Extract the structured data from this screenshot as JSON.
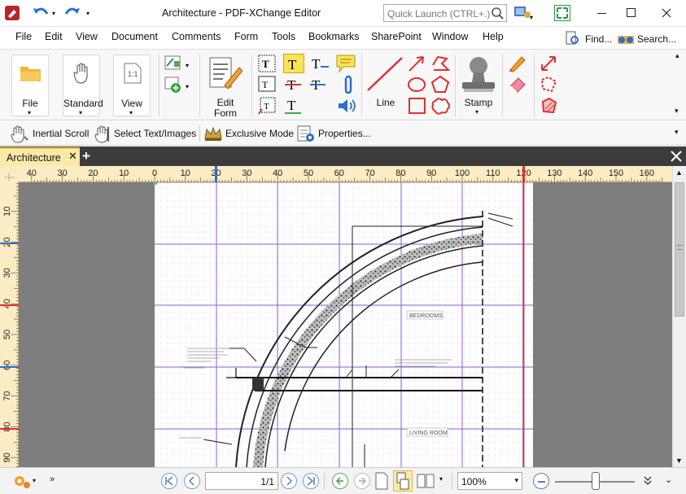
{
  "app": {
    "title": "Architecture - PDF-XChange Editor",
    "quick_launch_placeholder": "Quick Launch (CTRL+.)"
  },
  "menu": {
    "items": [
      "File",
      "Edit",
      "View",
      "Document",
      "Comments",
      "Form",
      "Tools",
      "Bookmarks",
      "SharePoint",
      "Window",
      "Help"
    ],
    "find": "Find...",
    "search": "Search..."
  },
  "ribbon": {
    "file": "File",
    "standard": "Standard",
    "view": "View",
    "edit_form_1": "Edit",
    "edit_form_2": "Form",
    "line": "Line",
    "stamp": "Stamp"
  },
  "toolbar2": {
    "inertial_scroll": "Inertial Scroll",
    "select_text": "Select Text/Images",
    "exclusive_mode": "Exclusive Mode",
    "properties": "Properties..."
  },
  "tab": {
    "name": "Architecture"
  },
  "rulers": {
    "h_ticks": [
      "40",
      "30",
      "20",
      "10",
      "0",
      "10",
      "20",
      "30",
      "40",
      "50",
      "60",
      "70",
      "80",
      "90",
      "100",
      "110",
      "120",
      "130",
      "140",
      "150",
      "160"
    ],
    "v_ticks": [
      "10",
      "20",
      "30",
      "40",
      "50",
      "60",
      "70",
      "80",
      "90"
    ]
  },
  "drawing": {
    "bedrooms": "BEDROOMS",
    "living_room": "LIVING ROOM"
  },
  "status": {
    "page_display": "1/1",
    "zoom": "100%"
  },
  "colors": {
    "accent": "#f0c040",
    "grid_major": "#8a5fd0",
    "grid_minor": "#c9c9e8",
    "ruler_bg": "#fbecc4",
    "red_marker": "#e03030",
    "blue_icon": "#2e6fc7"
  }
}
